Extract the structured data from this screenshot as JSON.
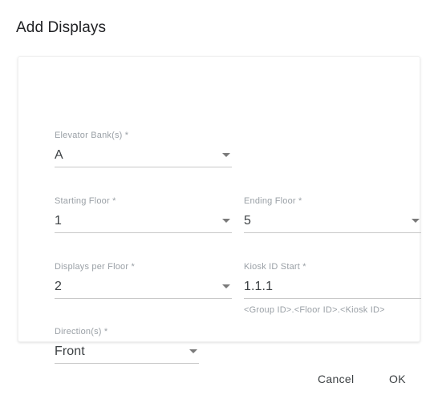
{
  "dialog": {
    "title": "Add Displays"
  },
  "form": {
    "fields": [
      {
        "name": "elevator-bank",
        "label": "Elevator Bank(s) *",
        "value": "A",
        "control": "select",
        "icon": "chevron-down-icon",
        "hint": ""
      },
      {
        "name": "starting-floor",
        "label": "Starting Floor *",
        "value": "1",
        "control": "select",
        "icon": "chevron-down-icon",
        "hint": ""
      },
      {
        "name": "ending-floor",
        "label": "Ending Floor *",
        "value": "5",
        "control": "select",
        "icon": "chevron-down-icon",
        "hint": ""
      },
      {
        "name": "displays-per-floor",
        "label": "Displays per Floor *",
        "value": "2",
        "control": "select",
        "icon": "chevron-down-icon",
        "hint": ""
      },
      {
        "name": "kiosk-id-start",
        "label": "Kiosk ID Start *",
        "value": "1.1.1",
        "control": "text",
        "icon": "",
        "hint": "<Group ID>.<Floor ID>.<Kiosk ID>"
      },
      {
        "name": "direction",
        "label": "Direction(s) *",
        "value": "Front",
        "control": "select",
        "icon": "chevron-down-icon",
        "hint": ""
      }
    ]
  },
  "actions": {
    "cancel_label": "Cancel",
    "ok_label": "OK"
  },
  "colors": {
    "page_background": "#ffffff",
    "card_background": "#ffffff",
    "card_border": "#f1f1f1",
    "label_text": "#9aa0a6",
    "value_text": "#3c4043",
    "underline": "#c8c8c8",
    "caret": "#7a7a7a",
    "title_text": "#202124"
  }
}
